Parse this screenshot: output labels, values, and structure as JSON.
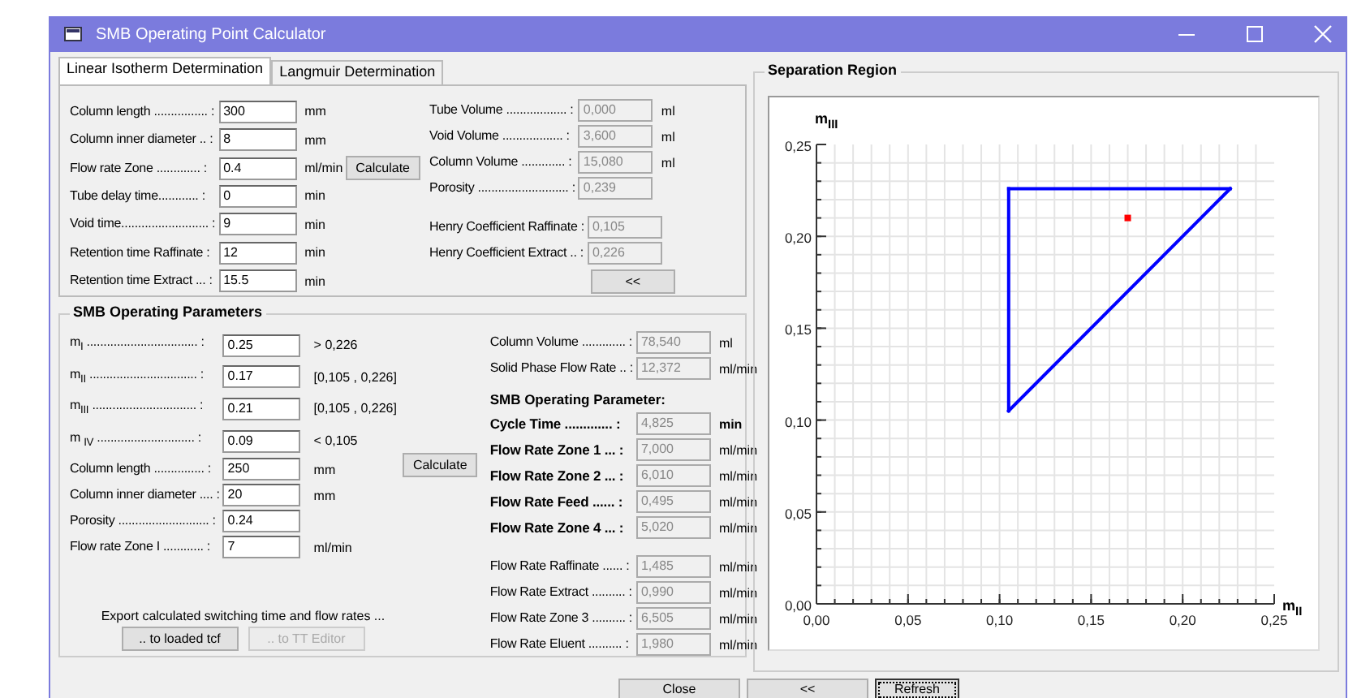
{
  "window": {
    "title": "SMB Operating Point Calculator"
  },
  "tabs": [
    {
      "label": "Linear Isotherm Determination",
      "selected": true
    },
    {
      "label": "Langmuir Determination",
      "selected": false
    }
  ],
  "linear_isotherm": {
    "inputs": [
      {
        "label": "Column length ................ :",
        "value": "300",
        "unit": "mm"
      },
      {
        "label": "Column inner diameter .. :",
        "value": "8",
        "unit": "mm"
      },
      {
        "label": "Flow rate Zone ............. :",
        "value": "0.4",
        "unit": "ml/min"
      },
      {
        "label": "Tube delay time............ :",
        "value": "0",
        "unit": "min"
      },
      {
        "label": "Void time.......................... :",
        "value": "9",
        "unit": "min"
      },
      {
        "label": "Retention time Raffinate :",
        "value": "12",
        "unit": "min"
      },
      {
        "label": "Retention time Extract ... :",
        "value": "15.5",
        "unit": "min"
      }
    ],
    "calculate_button": "Calculate",
    "outputs": [
      {
        "label": "Tube Volume .................. :",
        "value": "0,000",
        "unit": "ml"
      },
      {
        "label": "Void Volume .................. :",
        "value": "3,600",
        "unit": "ml"
      },
      {
        "label": "Column Volume ............. :",
        "value": "15,080",
        "unit": "ml"
      },
      {
        "label": "Porosity ........................... :",
        "value": "0,239"
      }
    ],
    "henry": [
      {
        "label": "Henry Coefficient Raffinate :",
        "value": "0,105"
      },
      {
        "label": "Henry Coefficient Extract .. :",
        "value": "0,226"
      }
    ],
    "back_button": "<<"
  },
  "smb": {
    "title": "SMB Operating Parameters",
    "inputs": [
      {
        "label": "m$_{I}$ ................................. :",
        "value": "0.25",
        "note": "> 0,226"
      },
      {
        "label": "m$_{II}$ ................................ :",
        "value": "0.17",
        "note": "[0,105 , 0,226]"
      },
      {
        "label": "m$_{III}$ ............................... :",
        "value": "0.21",
        "note": "[0,105 , 0,226]"
      },
      {
        "label": "m $_{IV}$ ............................. :",
        "value": "0.09",
        "note": "< 0,105"
      },
      {
        "label": "Column length ............... :",
        "value": "250",
        "note": "mm"
      },
      {
        "label": "Column inner diameter .... :",
        "value": "20",
        "note": "mm"
      },
      {
        "label": "Porosity ........................... :",
        "value": "0.24"
      },
      {
        "label": "Flow rate Zone I ............ :",
        "value": "7",
        "note": "ml/min"
      }
    ],
    "calculate_button": "Calculate",
    "results": [
      {
        "label": "Column Volume ............. :",
        "value": "78,540",
        "unit": "ml"
      },
      {
        "label": "Solid Phase Flow Rate .. :",
        "value": "12,372",
        "unit": "ml/min"
      }
    ],
    "operating_title": "SMB Operating Parameter:",
    "operating": [
      {
        "label": "Cycle Time ............. :",
        "value": "4,825",
        "unit": "min"
      },
      {
        "label": "Flow Rate Zone 1 ... :",
        "value": "7,000",
        "unit": "ml/min"
      },
      {
        "label": "Flow Rate Zone 2 ... :",
        "value": "6,010",
        "unit": "ml/min"
      },
      {
        "label": "Flow Rate Feed ...... :",
        "value": "0,495",
        "unit": "ml/min"
      },
      {
        "label": "Flow Rate Zone 4 ... :",
        "value": "5,020",
        "unit": "ml/min"
      }
    ],
    "flows": [
      {
        "label": "Flow Rate Raffinate ...... :",
        "value": "1,485",
        "unit": "ml/min"
      },
      {
        "label": "Flow Rate Extract .......... :",
        "value": "0,990",
        "unit": "ml/min"
      },
      {
        "label": "Flow Rate Zone 3 .......... :",
        "value": "6,505",
        "unit": "ml/min"
      },
      {
        "label": "Flow Rate Eluent .......... :",
        "value": "1,980",
        "unit": "ml/min"
      }
    ],
    "export_text": "Export calculated switching time and flow rates ...",
    "export_buttons": [
      {
        "label": ".. to loaded tcf",
        "disabled": false
      },
      {
        "label": ".. to TT Editor",
        "disabled": true
      }
    ]
  },
  "separation_region": {
    "title": "Separation Region",
    "chart_data": {
      "type": "line",
      "xlabel": "m$_{II}$",
      "ylabel": "m$_{III}$",
      "grid": true,
      "series": [
        {
          "color": "#0000ff",
          "x": [
            0.105,
            0.226
          ],
          "values": [
            0.105,
            0.226
          ]
        },
        {
          "color": "#0000ff",
          "x": [
            0.105,
            0.226
          ],
          "values": [
            0.226,
            0.226
          ]
        },
        {
          "color": "#0000ff",
          "x": [
            0.105,
            0.105
          ],
          "values": [
            0.105,
            0.226
          ]
        },
        {
          "color": "#ff0000",
          "marker": "square",
          "x": [
            0.17
          ],
          "values": [
            0.21
          ]
        }
      ],
      "xlim": [
        0,
        0.25
      ],
      "ylim": [
        0,
        0.25
      ],
      "xticks": [
        {
          "value": 0,
          "label": "0,00"
        },
        {
          "value": 0.05,
          "label": "0,05"
        },
        {
          "value": 0.1,
          "label": "0,10"
        },
        {
          "value": 0.15,
          "label": "0,15"
        },
        {
          "value": 0.2,
          "label": "0,20"
        },
        {
          "value": 0.25,
          "label": "0,25"
        }
      ],
      "yticks": [
        {
          "value": 0,
          "label": "0,00"
        },
        {
          "value": 0.05,
          "label": "0,05"
        },
        {
          "value": 0.1,
          "label": "0,10"
        },
        {
          "value": 0.15,
          "label": "0,15"
        },
        {
          "value": 0.2,
          "label": "0,20"
        },
        {
          "value": 0.25,
          "label": "0,25"
        }
      ]
    }
  },
  "bottom_buttons": [
    {
      "label": "Close",
      "focused": false
    },
    {
      "label": "<<",
      "focused": false
    },
    {
      "label": "Refresh",
      "focused": true
    }
  ]
}
